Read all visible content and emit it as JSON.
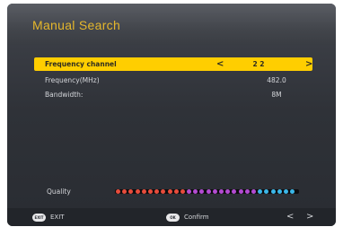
{
  "title": "Manual Search",
  "rows": [
    {
      "label": "Frequency channel",
      "value": "2 2"
    },
    {
      "label": "Frequency(MHz)",
      "value": "482.0"
    },
    {
      "label": "Bandwidth:",
      "value": "8M"
    }
  ],
  "quality": {
    "label": "Quality",
    "dot_colors": [
      "#e74c3c",
      "#e74c3c",
      "#e74c3c",
      "#e74c3c",
      "#e74c3c",
      "#e74c3c",
      "#e74c3c",
      "#e74c3c",
      "#e74c3c",
      "#e74c3c",
      "#e74c3c",
      "#b34bd2",
      "#b34bd2",
      "#b34bd2",
      "#b34bd2",
      "#b34bd2",
      "#b34bd2",
      "#b34bd2",
      "#b34bd2",
      "#b34bd2",
      "#b34bd2",
      "#b34bd2",
      "#3bb7e8",
      "#3bb7e8",
      "#3bb7e8",
      "#3bb7e8",
      "#3bb7e8",
      "#3bb7e8"
    ]
  },
  "footer": {
    "exit_badge": "EXIT",
    "exit_label": "EXIT",
    "ok_badge": "OK",
    "confirm_label": "Confirm",
    "left_arrow": "<",
    "right_arrow": ">"
  },
  "colors": {
    "accent": "#ffce00",
    "title": "#e5b72c"
  },
  "icons": {
    "left": "chevron-left-icon",
    "right": "chevron-right-icon"
  }
}
